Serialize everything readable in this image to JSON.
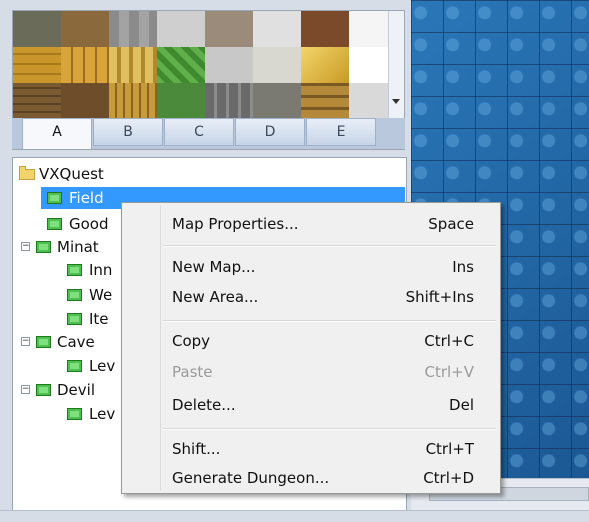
{
  "palette": {
    "tabs": [
      "A",
      "B",
      "C",
      "D",
      "E"
    ],
    "active_tab": "A"
  },
  "tree": {
    "root": "VXQuest",
    "nodes": [
      "Field",
      "Good",
      "Minat",
      "Inn",
      "We",
      "Ite",
      "Cave",
      "Lev",
      "Devil",
      "Lev"
    ],
    "selected": "Field"
  },
  "context_menu": {
    "items": [
      {
        "label": "Map Properties...",
        "shortcut": "Space",
        "enabled": true
      },
      {
        "label": "New Map...",
        "shortcut": "Ins",
        "enabled": true
      },
      {
        "label": "New Area...",
        "shortcut": "Shift+Ins",
        "enabled": true
      },
      {
        "label": "Copy",
        "shortcut": "Ctrl+C",
        "enabled": true
      },
      {
        "label": "Paste",
        "shortcut": "Ctrl+V",
        "enabled": false
      },
      {
        "label": "Delete...",
        "shortcut": "Del",
        "enabled": true
      },
      {
        "label": "Shift...",
        "shortcut": "Ctrl+T",
        "enabled": true
      },
      {
        "label": "Generate Dungeon...",
        "shortcut": "Ctrl+D",
        "enabled": true
      }
    ]
  },
  "icons": {
    "folder": "folder-icon",
    "map": "map-icon",
    "collapse": "collapse-icon"
  },
  "colors": {
    "selection": "#3399ff",
    "water": "#1e5f9e",
    "map_icon": "#4fc04f",
    "disabled_text": "#9a9a9a"
  }
}
